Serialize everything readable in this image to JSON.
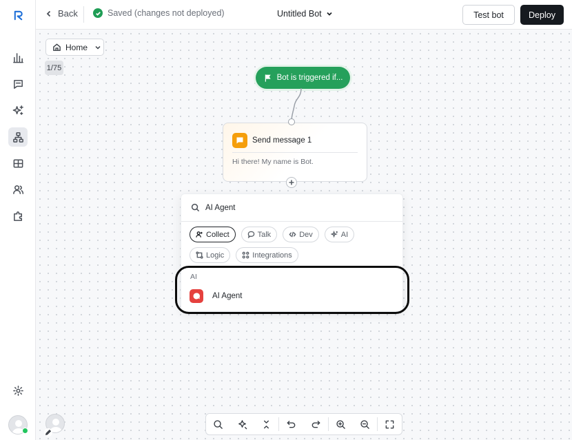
{
  "topbar": {
    "back_label": "Back",
    "saved_status": "Saved (changes not deployed)",
    "bot_name": "Untitled Bot",
    "test_label": "Test bot",
    "deploy_label": "Deploy"
  },
  "sidebar": {
    "items": [
      {
        "icon": "logo-icon"
      },
      {
        "icon": "analytics-icon"
      },
      {
        "icon": "chat-icon"
      },
      {
        "icon": "ai-sparkles-icon"
      },
      {
        "icon": "flow-builder-icon",
        "active": true
      },
      {
        "icon": "tickets-icon"
      },
      {
        "icon": "contacts-icon"
      },
      {
        "icon": "integrations-icon"
      },
      {
        "icon": "settings-icon"
      }
    ]
  },
  "canvas": {
    "home_label": "Home",
    "pager": "1/75",
    "trigger_label": "Bot is triggered if...",
    "message_node": {
      "title": "Send message 1",
      "body": "Hi there! My name is Bot."
    }
  },
  "picker": {
    "search_value": "AI Agent",
    "chips": [
      {
        "label": "Collect",
        "icon": "collect-icon",
        "active": true
      },
      {
        "label": "Talk",
        "icon": "talk-icon",
        "active": false
      },
      {
        "label": "Dev",
        "icon": "code-icon",
        "active": false
      },
      {
        "label": "AI",
        "icon": "ai-sparkles-icon",
        "active": false
      },
      {
        "label": "Logic",
        "icon": "logic-icon",
        "active": false
      },
      {
        "label": "Integrations",
        "icon": "integrations-icon",
        "active": false
      }
    ],
    "category": "AI",
    "result_label": "AI Agent"
  },
  "toolbar": {
    "buttons": [
      "search-icon",
      "auto-arrange-icon",
      "collapse-icon",
      "undo-icon",
      "redo-icon",
      "zoom-in-icon",
      "zoom-out-icon",
      "fullscreen-icon"
    ]
  },
  "colors": {
    "trigger": "#25a05b",
    "message_icon": "#f59e0b",
    "ai_agent_icon": "#e5413e",
    "deploy": "#161a1f",
    "online": "#22c55e"
  }
}
